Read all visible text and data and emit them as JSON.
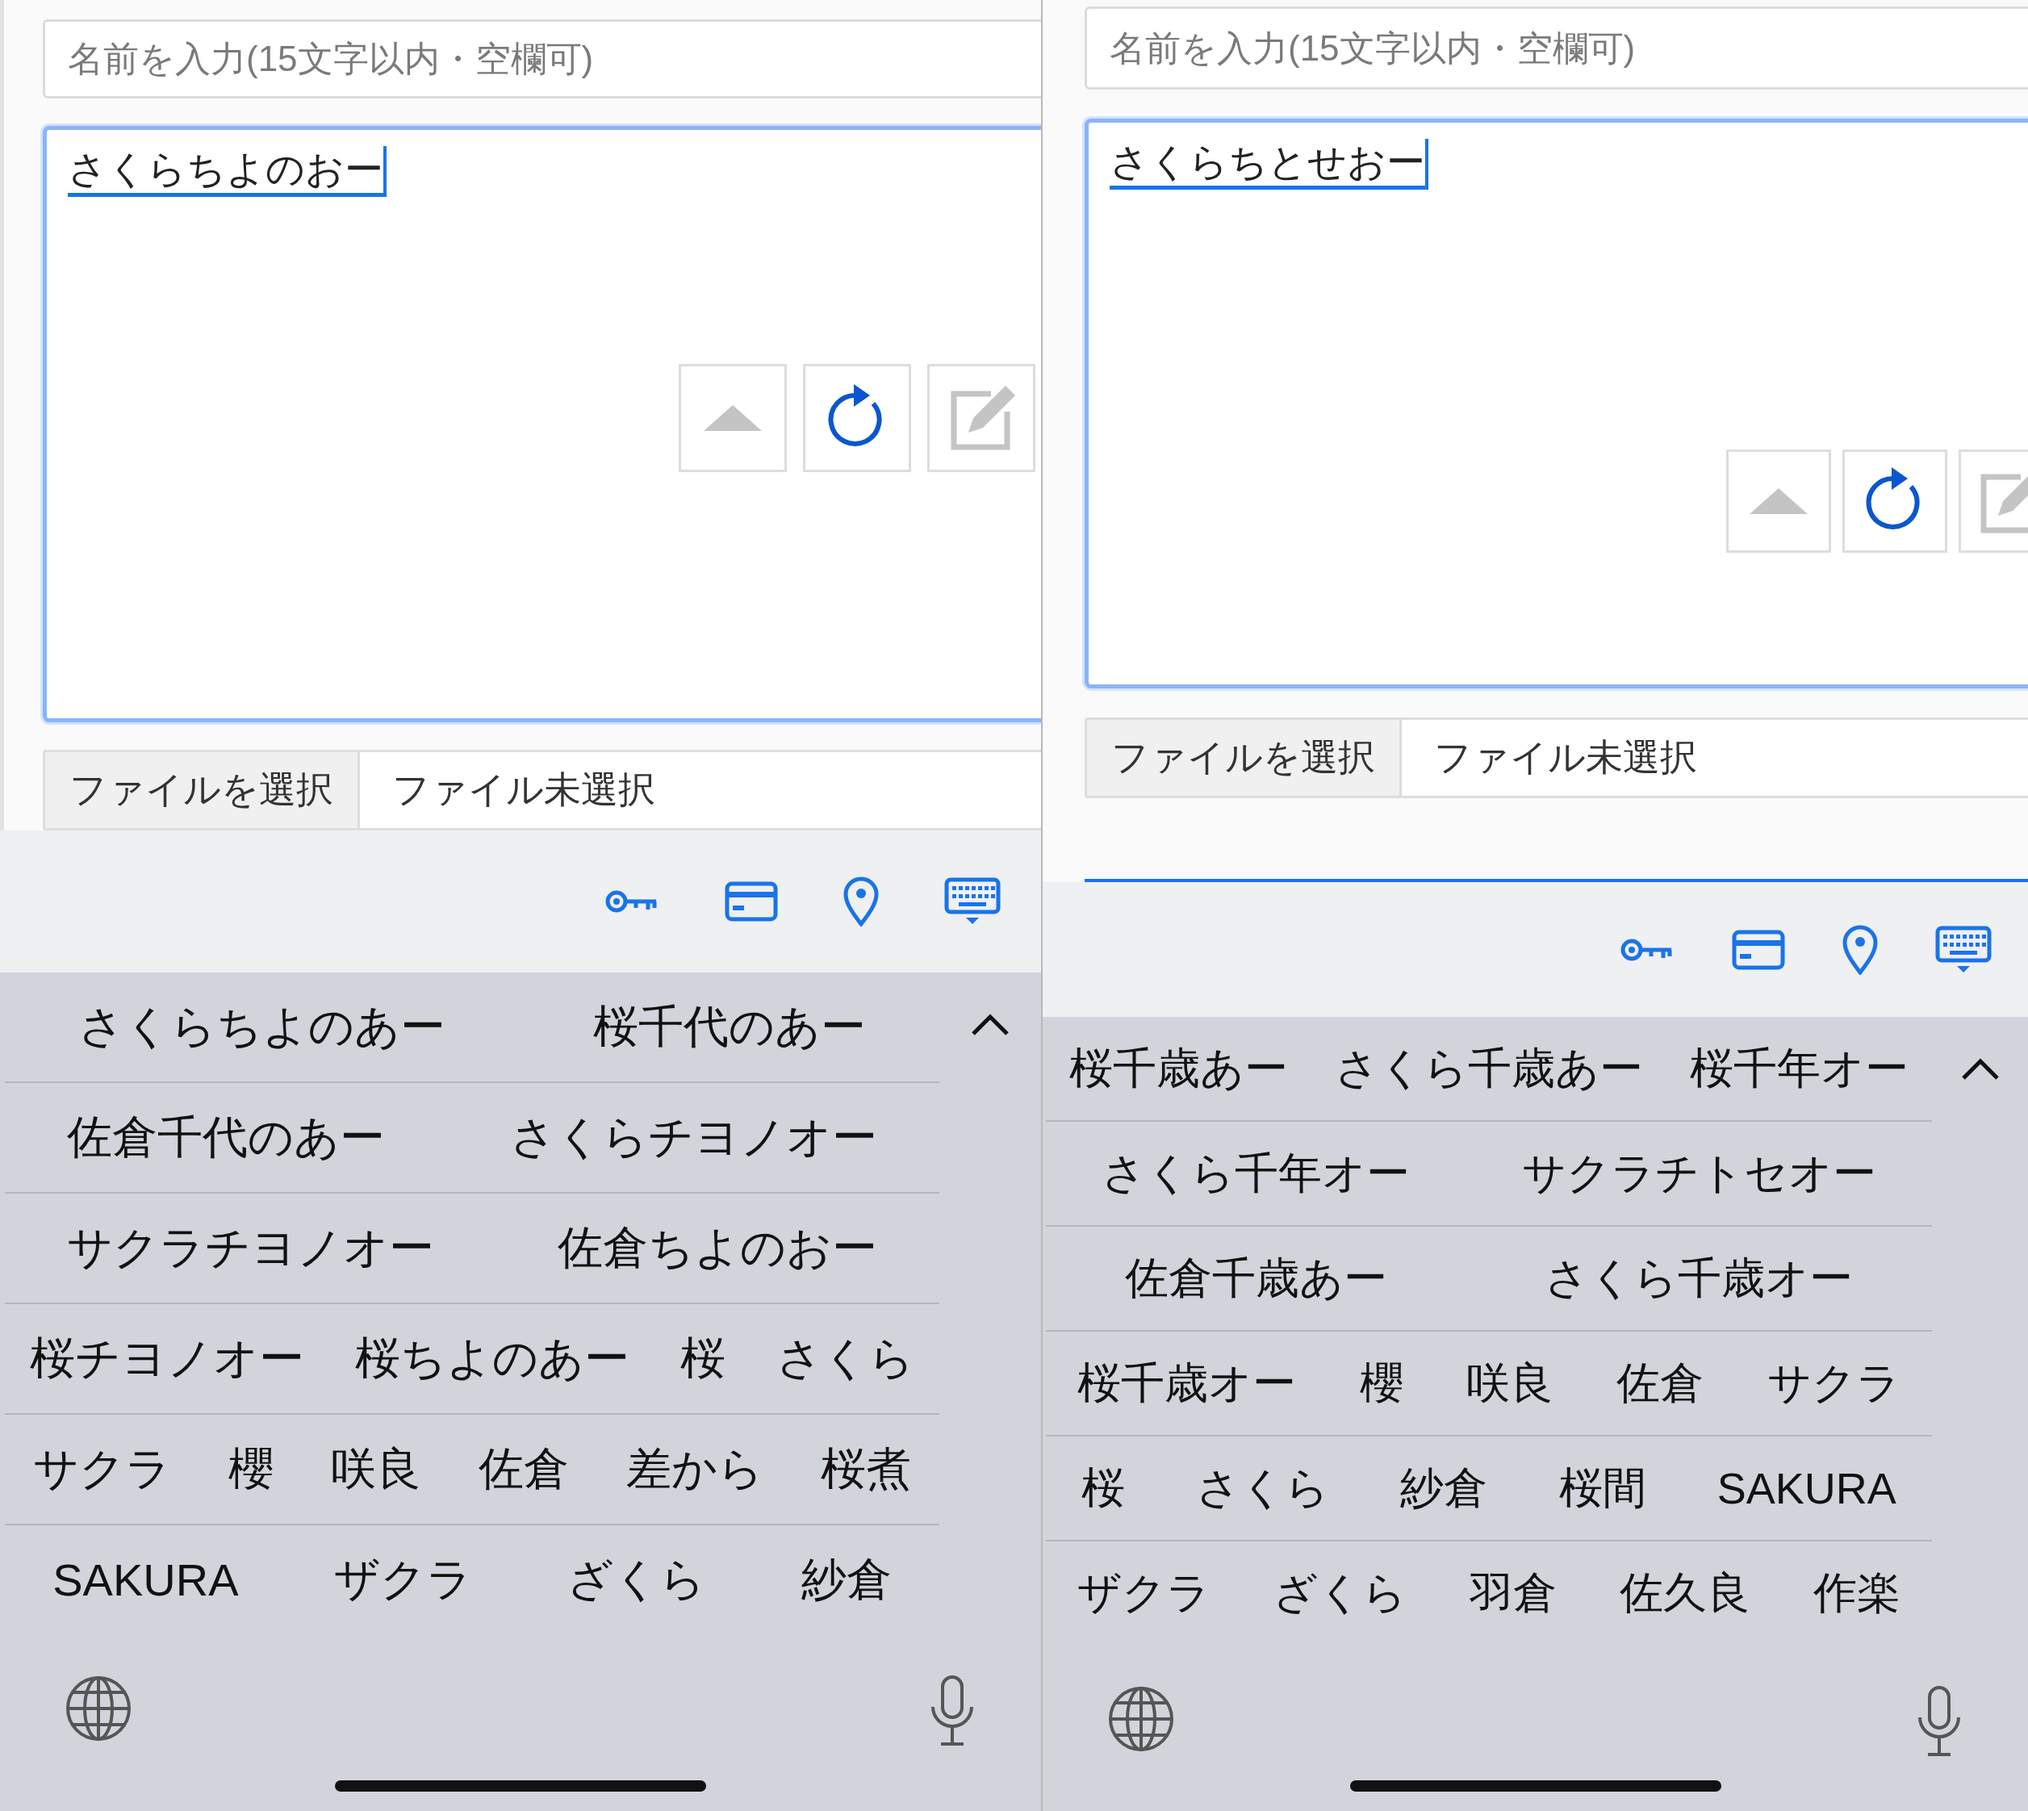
{
  "panels": [
    {
      "name_field": {
        "placeholder": "名前を入力(15文字以内・空欄可)"
      },
      "text_area": {
        "value": "さくらちよのおー",
        "composing": true
      },
      "file_picker": {
        "button": "ファイルを選択",
        "status": "ファイル未選択"
      },
      "focus_rule": false,
      "candidates": [
        [
          "さくらちよのあー",
          "桜千代のあー"
        ],
        [
          "佐倉千代のあー",
          "さくらチヨノオー"
        ],
        [
          "サクラチヨノオー",
          "佐倉ちよのおー"
        ],
        [
          "桜チヨノオー",
          "桜ちよのあー",
          "桜",
          "さくら"
        ],
        [
          "サクラ",
          "櫻",
          "咲良",
          "佐倉",
          "差から",
          "桜煮"
        ],
        [
          "SAKURA",
          "ザクラ",
          "ざくら",
          "紗倉"
        ]
      ]
    },
    {
      "name_field": {
        "placeholder": "名前を入力(15文字以内・空欄可)"
      },
      "text_area": {
        "value": "さくらちとせおー",
        "composing": true
      },
      "file_picker": {
        "button": "ファイルを選択",
        "status": "ファイル未選択"
      },
      "focus_rule": true,
      "candidates": [
        [
          "桜千歳あー",
          "さくら千歳あー",
          "桜千年オー"
        ],
        [
          "さくら千年オー",
          "サクラチトセオー"
        ],
        [
          "佐倉千歳あー",
          "さくら千歳オー"
        ],
        [
          "桜千歳オー",
          "櫻",
          "咲良",
          "佐倉",
          "サクラ"
        ],
        [
          "桜",
          "さくら",
          "紗倉",
          "桜間",
          "SAKURA"
        ],
        [
          "ザクラ",
          "ざくら",
          "羽倉",
          "佐久良",
          "作楽"
        ]
      ]
    }
  ]
}
